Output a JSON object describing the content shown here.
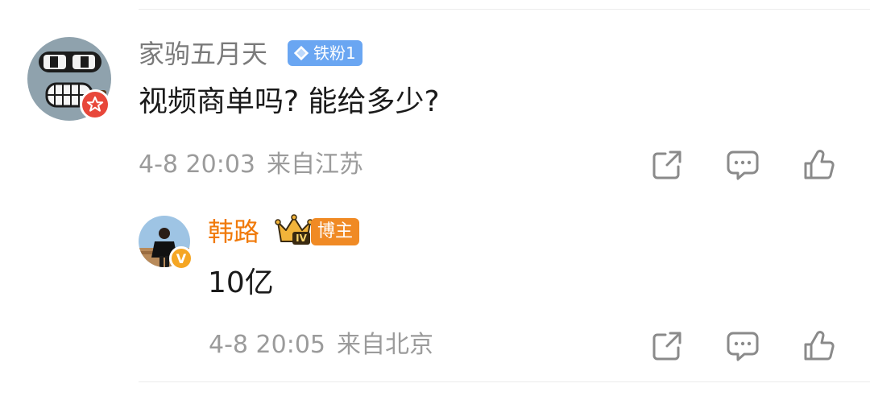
{
  "comment": {
    "username": "家驹五月天",
    "fan_badge_label": "铁粉1",
    "text": "视频商单吗? 能给多少?",
    "time": "4-8 20:03",
    "location": "来自江苏",
    "icons": [
      "share-icon",
      "comment-icon",
      "like-icon"
    ],
    "avatar_icon": "robot-face-icon",
    "avatar_badge_icon": "star-badge-icon"
  },
  "reply": {
    "username": "韩路",
    "crown_label": "IV",
    "host_badge_label": "博主",
    "text": "10亿",
    "time": "4-8 20:05",
    "location": "来自北京",
    "icons": [
      "share-icon",
      "comment-icon",
      "like-icon"
    ],
    "avatar_badge_icon": "verified-v-icon"
  },
  "colors": {
    "reply_username": "#f07a0a",
    "meta_text": "#9b9b9b",
    "fan_badge": "#6aa6f2",
    "host_badge": "#f08a24",
    "verified_badge": "#f5a623",
    "star_badge": "#e8473a"
  }
}
